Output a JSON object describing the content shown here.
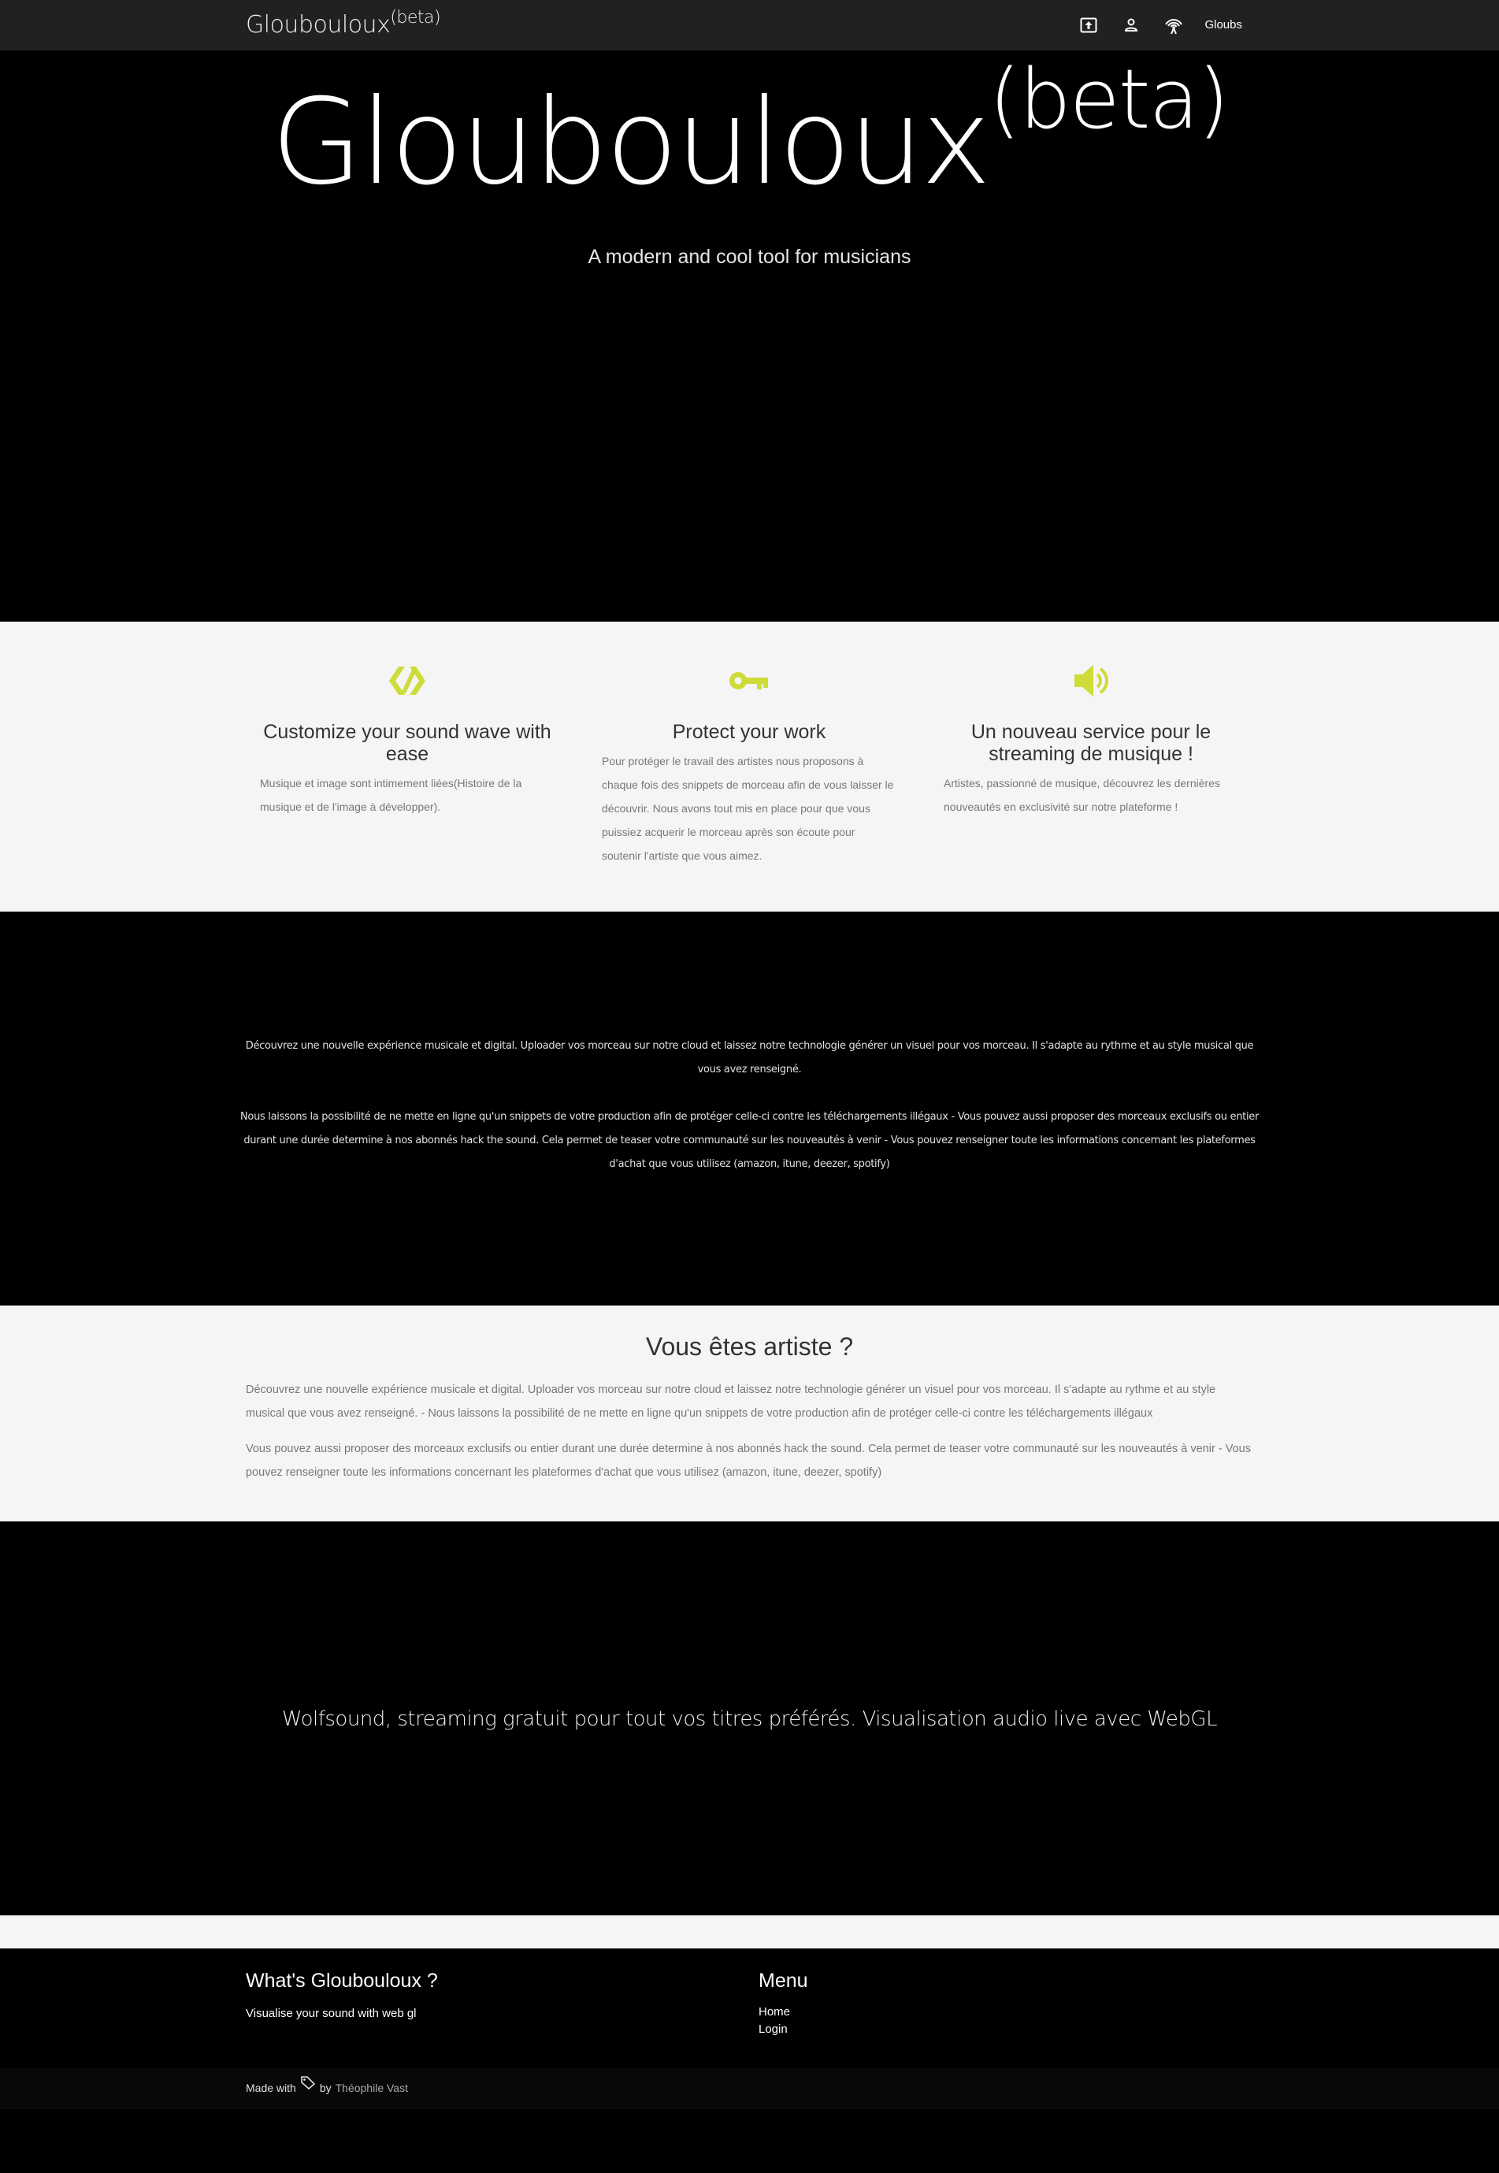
{
  "nav": {
    "brand": "Gloubouloux",
    "brand_sup": "(beta)",
    "icons": [
      "upload-icon",
      "person-icon",
      "broadcast-icon"
    ],
    "link": "Gloubs"
  },
  "hero": {
    "title": "Gloubouloux",
    "title_sup": "(beta)",
    "subtitle": "A modern and cool tool for musicians"
  },
  "features": [
    {
      "icon": "code-icon",
      "title": "Customize your sound wave with ease",
      "text": "Musique et image sont intimement liées(Histoire de la musique et de l'image à développer)."
    },
    {
      "icon": "key-icon",
      "title": "Protect your work",
      "text": "Pour protéger le travail des artistes nous proposons à chaque fois des snippets de morceau afin de vous laisser le découvrir. Nous avons tout mis en place pour que vous puissiez acquerir le morceau après son écoute pour soutenir l'artiste que vous aimez."
    },
    {
      "icon": "volume-icon",
      "title": "Un nouveau service pour le streaming de musique !",
      "text": "Artistes, passionné de musique, découvrez les dernières nouveautés en exclusivité sur notre plateforme !"
    }
  ],
  "accent_color": "#cddc39",
  "dark_text": {
    "p1": "Découvrez une nouvelle expérience musicale et digital. Uploader vos morceau sur notre cloud et laissez notre technologie générer un visuel pour vos morceau. Il s'adapte au rythme et au style musical que vous avez renseigné.",
    "p2": "Nous laissons la possibilité de ne mette en ligne qu'un snippets de votre production afin de protéger celle-ci contre les téléchargements illégaux - Vous pouvez aussi proposer des morceaux exclusifs ou entier durant une durée determine à nos abonnés hack the sound. Cela permet de teaser votre communauté sur les nouveautés à venir - Vous pouvez renseigner toute les informations concernant les plateformes d'achat que vous utilisez (amazon, itune, deezer, spotify)"
  },
  "artist": {
    "title": "Vous êtes artiste ?",
    "p1": "Découvrez une nouvelle expérience musicale et digital. Uploader vos morceau sur notre cloud et laissez notre technologie générer un visuel pour vos morceau. Il s'adapte au rythme et au style musical que vous avez renseigné. - Nous laissons la possibilité de ne mette en ligne qu'un snippets de votre production afin de protéger celle-ci contre les téléchargements illégaux",
    "p2": "Vous pouvez aussi proposer des morceaux exclusifs ou entier durant une durée determine à nos abonnés hack the sound. Cela permet de teaser votre communauté sur les nouveautés à venir - Vous pouvez renseigner toute les informations concernant les plateformes d'achat que vous utilisez (amazon, itune, deezer, spotify)"
  },
  "slogan": "Wolfsound, streaming gratuit pour tout vos titres préférés. Visualisation audio live avec WebGL",
  "footer": {
    "about_title": "What's Gloubouloux ?",
    "about_text": "Visualise your sound with web gl",
    "menu_title": "Menu",
    "menu_items": [
      "Home",
      "Login"
    ],
    "made_with": "Made with",
    "by": "by",
    "author": "Théophile Vast"
  }
}
